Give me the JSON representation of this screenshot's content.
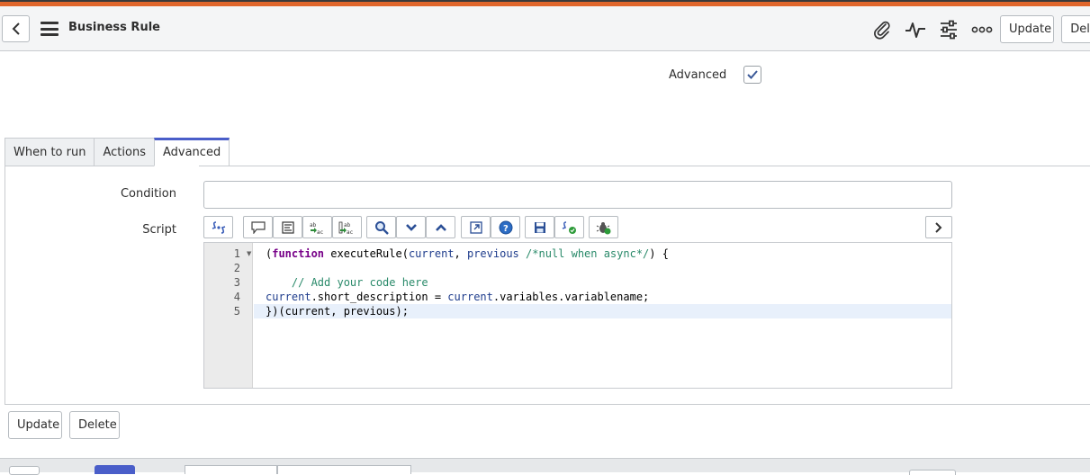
{
  "header": {
    "title": "Business Rule",
    "update_label": "Update",
    "delete_label": "Dele",
    "icons": [
      "chevron-left-icon",
      "menu-icon",
      "paperclip-icon",
      "activity-icon",
      "sliders-icon",
      "more-icon"
    ]
  },
  "form": {
    "advanced_label": "Advanced",
    "advanced_checked": true
  },
  "tabs": [
    {
      "label": "When to run"
    },
    {
      "label": "Actions"
    },
    {
      "label": "Advanced"
    }
  ],
  "advanced_tab": {
    "condition_label": "Condition",
    "condition_value": "",
    "script_label": "Script"
  },
  "editor": {
    "line_numbers": [
      "1",
      "2",
      "3",
      "4",
      "5"
    ],
    "lines": [
      "(function executeRule(current, previous /*null when async*/) {",
      "",
      "    // Add your code here",
      "current.short_description = current.variables.variablename;",
      "})(current, previous);"
    ]
  },
  "bottom": {
    "update_label": "Update",
    "delete_label": "Delete"
  },
  "colors": {
    "accent_bar": "#e0662b",
    "active_tab": "#4a5ec9",
    "keyword": "#770088",
    "comment": "#2a8a6a"
  }
}
